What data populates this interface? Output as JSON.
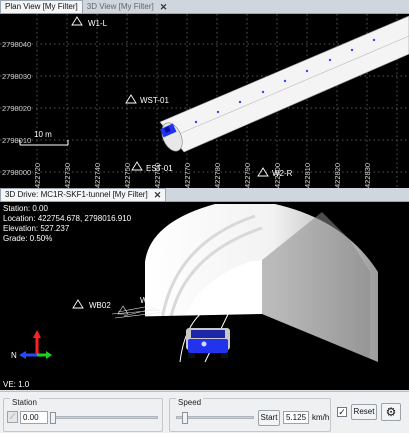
{
  "top_tabs": [
    {
      "label": "Plan View [My Filter]",
      "active": true
    },
    {
      "label": "3D View [My Filter]",
      "active": false
    }
  ],
  "plan": {
    "y_labels": [
      "2798040",
      "2798030",
      "2798020",
      "2798010",
      "2798000"
    ],
    "x_labels": [
      "422720",
      "422730",
      "422740",
      "422750",
      "422760",
      "422770",
      "422780",
      "422790",
      "422800",
      "422810",
      "422820",
      "422830"
    ],
    "points": [
      "W1-L",
      "WST-01",
      "EST-01",
      "W2-R"
    ],
    "scale_label": "10 m"
  },
  "drive_tab": {
    "label": "3D Drive: MC1R-SKF1-tunnel [My Filter]"
  },
  "hud": {
    "station": "Station: 0.00",
    "location": "Location: 422754.678, 2798016.910",
    "elevation": "Elevation: 527.237",
    "grade": "Grade: 0.50%",
    "ve": "VE: 1.0"
  },
  "drive_labels": {
    "wb02": "WB02",
    "w": "W"
  },
  "axes": {
    "north": "N"
  },
  "controls": {
    "station_group": "Station",
    "station_value": "0.00",
    "speed_group": "Speed",
    "start_label": "Start",
    "speed_value": "5.125",
    "speed_unit": "km/h",
    "reset_label": "Reset",
    "checkbox_checked": true
  },
  "colors": {
    "grid": "#7a7a7a",
    "tunnel": "#f2f2f2",
    "accent_blue": "#2a3cff",
    "car_body": "#2233ee"
  }
}
